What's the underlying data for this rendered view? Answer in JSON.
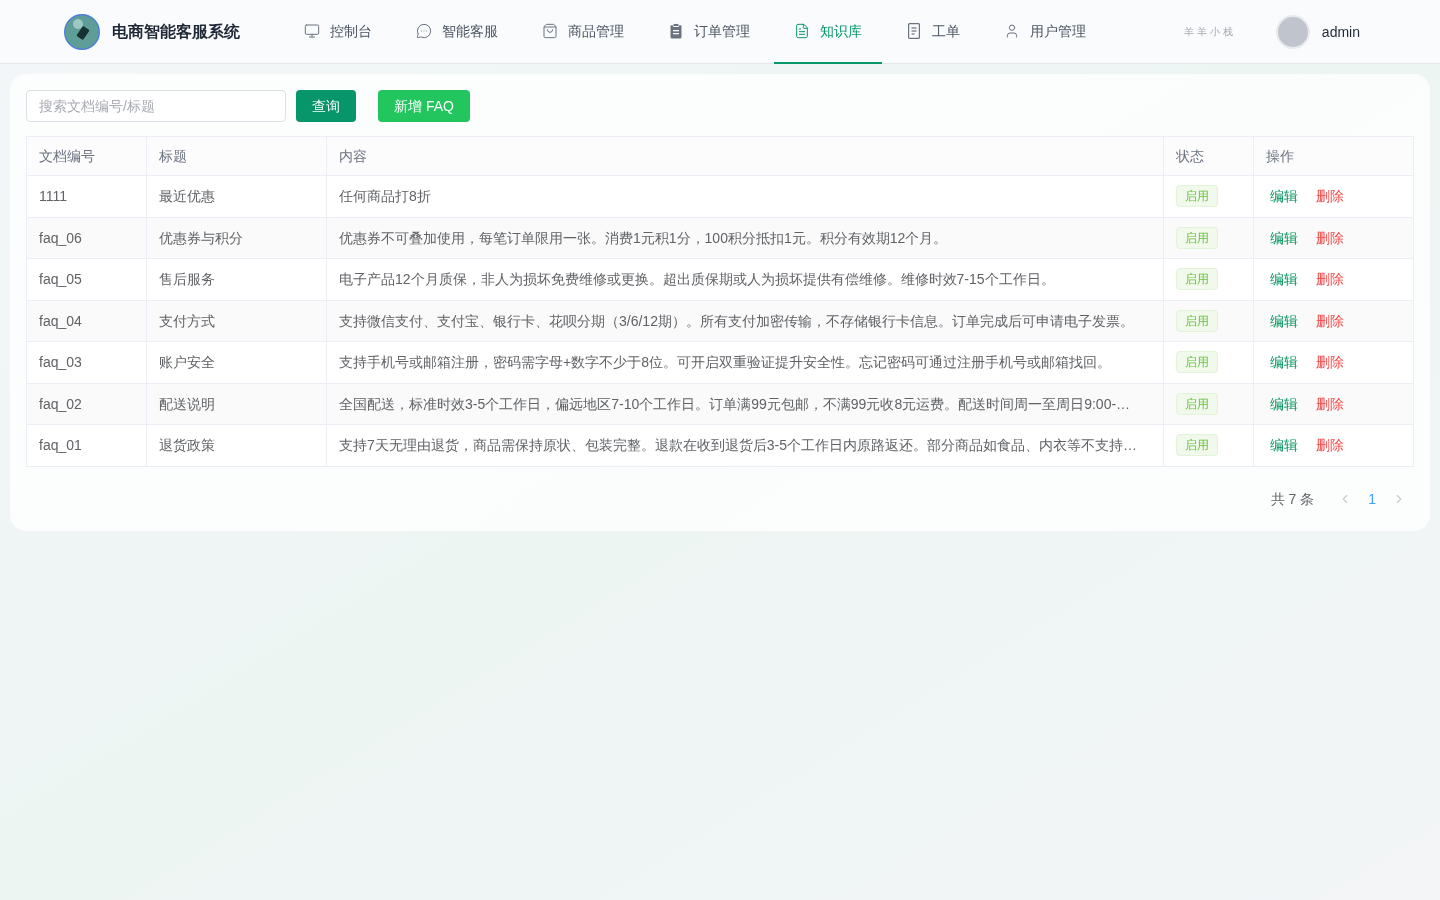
{
  "header": {
    "title": "电商智能客服系统",
    "nav": [
      {
        "label": "控制台",
        "selected": false
      },
      {
        "label": "智能客服",
        "selected": false
      },
      {
        "label": "商品管理",
        "selected": false
      },
      {
        "label": "订单管理",
        "selected": false
      },
      {
        "label": "知识库",
        "selected": true
      },
      {
        "label": "工单",
        "selected": false
      },
      {
        "label": "用户管理",
        "selected": false
      }
    ],
    "tag": "羊羊小栈",
    "user": "admin"
  },
  "toolbar": {
    "search": {
      "placeholder": "搜索文档编号/标题"
    },
    "buttons": [
      {
        "label": "查询",
        "kind": "search"
      },
      {
        "label": "新增 FAQ",
        "kind": "add"
      }
    ]
  },
  "table": {
    "columns": [
      "文档编号",
      "标题",
      "内容",
      "状态",
      "操作"
    ],
    "rows": [
      {
        "id": "1111",
        "title": "最近优惠",
        "content": "任何商品打8折",
        "status": "启用",
        "actions": [
          {
            "label": "编辑",
            "kind": "edit"
          },
          {
            "label": "删除",
            "kind": "delete"
          }
        ]
      },
      {
        "id": "faq_06",
        "title": "优惠券与积分",
        "content": "优惠券不可叠加使用，每笔订单限用一张。消费1元积1分，100积分抵扣1元。积分有效期12个月。",
        "status": "启用",
        "actions": [
          {
            "label": "编辑",
            "kind": "edit"
          },
          {
            "label": "删除",
            "kind": "delete"
          }
        ]
      },
      {
        "id": "faq_05",
        "title": "售后服务",
        "content": "电子产品12个月质保，非人为损坏免费维修或更换。超出质保期或人为损坏提供有偿维修。维修时效7-15个工作日。",
        "status": "启用",
        "actions": [
          {
            "label": "编辑",
            "kind": "edit"
          },
          {
            "label": "删除",
            "kind": "delete"
          }
        ]
      },
      {
        "id": "faq_04",
        "title": "支付方式",
        "content": "支持微信支付、支付宝、银行卡、花呗分期（3/6/12期）。所有支付加密传输，不存储银行卡信息。订单完成后可申请电子发票。",
        "status": "启用",
        "actions": [
          {
            "label": "编辑",
            "kind": "edit"
          },
          {
            "label": "删除",
            "kind": "delete"
          }
        ]
      },
      {
        "id": "faq_03",
        "title": "账户安全",
        "content": "支持手机号或邮箱注册，密码需字母+数字不少于8位。可开启双重验证提升安全性。忘记密码可通过注册手机号或邮箱找回。",
        "status": "启用",
        "actions": [
          {
            "label": "编辑",
            "kind": "edit"
          },
          {
            "label": "删除",
            "kind": "delete"
          }
        ]
      },
      {
        "id": "faq_02",
        "title": "配送说明",
        "content": "全国配送，标准时效3-5个工作日，偏远地区7-10个工作日。订单满99元包邮，不满99元收8元运费。配送时间周一至周日9:00-…",
        "status": "启用",
        "actions": [
          {
            "label": "编辑",
            "kind": "edit"
          },
          {
            "label": "删除",
            "kind": "delete"
          }
        ]
      },
      {
        "id": "faq_01",
        "title": "退货政策",
        "content": "支持7天无理由退货，商品需保持原状、包装完整。退款在收到退货后3-5个工作日内原路返还。部分商品如食品、内衣等不支持…",
        "status": "启用",
        "actions": [
          {
            "label": "编辑",
            "kind": "edit"
          },
          {
            "label": "删除",
            "kind": "delete"
          }
        ]
      }
    ]
  },
  "pagination": {
    "total": "共 7 条",
    "prev": {
      "disabled": true
    },
    "pages": [
      {
        "label": "1",
        "selected": true
      }
    ],
    "next": {
      "disabled": true
    }
  }
}
